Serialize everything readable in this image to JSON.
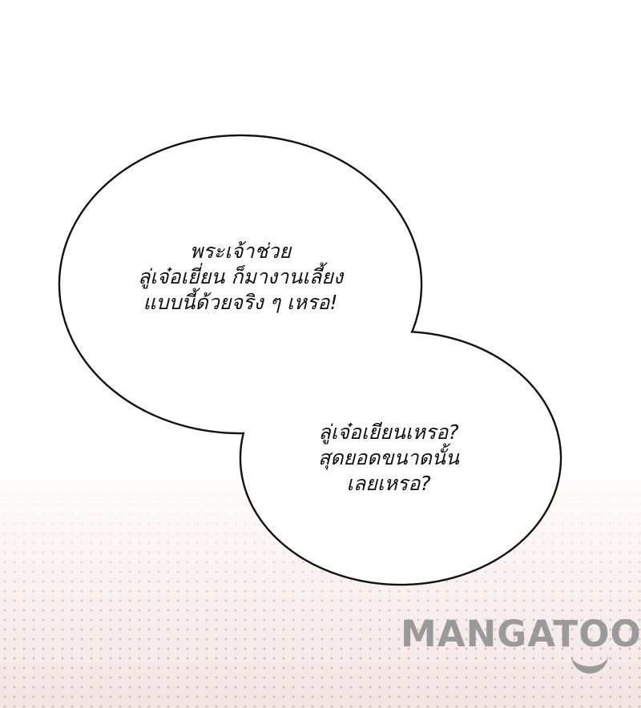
{
  "bubbles": [
    {
      "lines": [
        "พระเจ้าช่วย",
        "ลู่เจ๋อเยี่ยน ก็มางานเลี้ยง",
        "แบบนี้ด้วยจริง ๆ เหรอ!"
      ]
    },
    {
      "lines": [
        "ลู่เจ๋อเยียนเหรอ?",
        "สุดยอดขนาดนั้น",
        "เลยเหรอ?"
      ]
    }
  ],
  "watermark": "MANGATOON"
}
